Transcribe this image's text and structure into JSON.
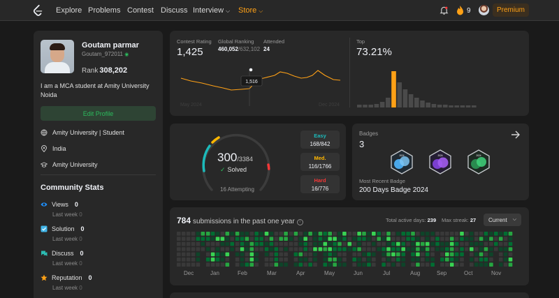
{
  "nav": {
    "items": [
      "Explore",
      "Problems",
      "Contest",
      "Discuss",
      "Interview",
      "Store"
    ],
    "streak": "9",
    "premium": "Premium"
  },
  "profile": {
    "name": "Goutam parmar",
    "handle": "Goutam_972011",
    "rank_label": "Rank",
    "rank": "308,202",
    "bio": "I am a MCA student at Amity University Noida",
    "edit_button": "Edit Profile",
    "info": [
      "Amity University | Student",
      "India",
      "Amity University"
    ]
  },
  "community": {
    "title": "Community Stats",
    "stats": [
      {
        "label": "Views",
        "value": "0",
        "sub": "Last week",
        "sub_value": "0",
        "color": "#1e90ff"
      },
      {
        "label": "Solution",
        "value": "0",
        "sub": "Last week",
        "sub_value": "0",
        "color": "#41b5e8"
      },
      {
        "label": "Discuss",
        "value": "0",
        "sub": "Last week",
        "sub_value": "0",
        "color": "#2cbbb2"
      },
      {
        "label": "Reputation",
        "value": "0",
        "sub": "Last week",
        "sub_value": "0",
        "color": "#ffa116"
      }
    ]
  },
  "contest": {
    "rating_label": "Contest Rating",
    "rating": "1,425",
    "global_label": "Global Ranking",
    "global_rank": "460,052",
    "global_total": "/632,102",
    "attended_label": "Attended",
    "attended": "24",
    "top_label": "Top",
    "top_pct": "73.21%",
    "tooltip": "1,516",
    "x_start": "May 2024",
    "x_end": "Dec 2024"
  },
  "solved": {
    "count": "300",
    "total": "/3384",
    "label": "Solved",
    "attempting": "16 Attempting",
    "easy_label": "Easy",
    "easy": "168/842",
    "medium_label": "Med.",
    "medium": "116/1766",
    "hard_label": "Hard",
    "hard": "16/776",
    "colors": {
      "easy": "#1cbaba",
      "medium": "#ffb700",
      "hard": "#f63737"
    }
  },
  "badges": {
    "title": "Badges",
    "count": "3",
    "recent_label": "Most Recent Badge",
    "recent_name": "200 Days Badge 2024",
    "items": [
      {
        "name": "100 Days Badge",
        "text": "2024",
        "color": "#5aa5e6"
      },
      {
        "name": "200 Days Badge 2024",
        "text": "2024",
        "color": "#9a4fe0"
      },
      {
        "name": "50 Days Badge",
        "text": "2024",
        "color": "#2cbb5d"
      }
    ]
  },
  "submissions": {
    "count": "784",
    "label": "submissions in the past one year",
    "active_label": "Total active days:",
    "active_days": "239",
    "streak_label": "Max streak:",
    "max_streak": "27",
    "dropdown": "Current",
    "months": [
      "Dec",
      "Jan",
      "Feb",
      "Mar",
      "Apr",
      "May",
      "Jun",
      "Jul",
      "Aug",
      "Sep",
      "Oct",
      "Nov"
    ]
  }
}
